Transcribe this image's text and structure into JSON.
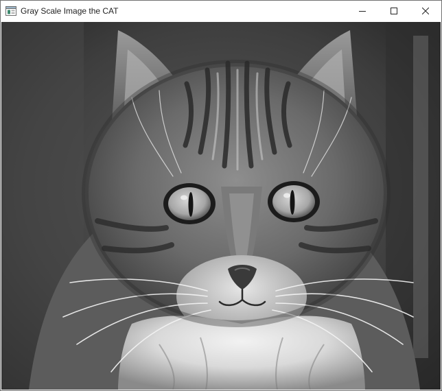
{
  "window": {
    "title": "Gray Scale Image the CAT"
  },
  "icons": {
    "app": "app-window-icon",
    "minimize": "minimize-icon",
    "maximize": "maximize-icon",
    "close": "close-icon"
  },
  "colors": {
    "border": "#6f6f6f",
    "titlebar_bg": "#ffffff",
    "close_hover": "#e81123"
  }
}
